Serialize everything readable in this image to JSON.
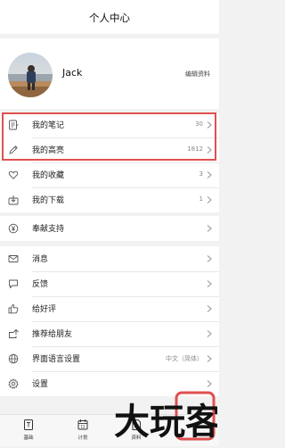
{
  "header": {
    "title": "个人中心"
  },
  "profile": {
    "name": "Jack",
    "edit_label": "编辑资料"
  },
  "section_a": [
    {
      "label": "我的笔记",
      "value": "30",
      "icon": "notes-icon"
    },
    {
      "label": "我的高亮",
      "value": "1812",
      "icon": "pencil-icon"
    },
    {
      "label": "我的收藏",
      "value": "3",
      "icon": "heart-icon"
    },
    {
      "label": "我的下载",
      "value": "1",
      "icon": "download-box-icon"
    }
  ],
  "section_b": [
    {
      "label": "奉献支持",
      "icon": "yen-coin-icon"
    }
  ],
  "section_c": [
    {
      "label": "消息",
      "icon": "envelope-icon"
    },
    {
      "label": "反馈",
      "icon": "chat-bubble-icon"
    },
    {
      "label": "给好评",
      "icon": "thumbs-up-icon"
    },
    {
      "label": "推荐给朋友",
      "icon": "share-icon"
    },
    {
      "label": "界面语言设置",
      "value": "中文（简体）",
      "icon": "globe-icon"
    },
    {
      "label": "设置",
      "icon": "gear-icon"
    }
  ],
  "tabbar": [
    {
      "label": "基础",
      "icon": "book-icon"
    },
    {
      "label": "计划",
      "icon": "calendar-icon"
    },
    {
      "label": "资料",
      "icon": "document-icon"
    }
  ],
  "watermark": {
    "text": "大玩客"
  },
  "colors": {
    "highlight": "#e05050",
    "background": "#f2f2f2"
  }
}
